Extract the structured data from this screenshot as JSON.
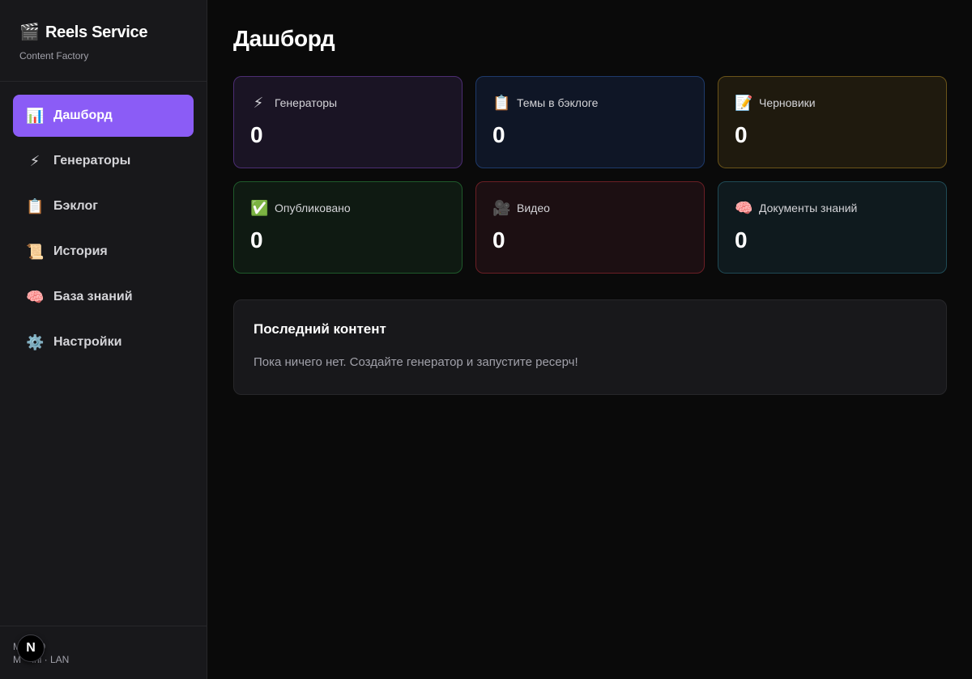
{
  "brand": {
    "icon": "🎬",
    "title": "Reels Service",
    "subtitle": "Content Factory"
  },
  "nav": [
    {
      "icon": "📊",
      "label": "Дашборд",
      "active": true
    },
    {
      "icon": "⚡",
      "label": "Генераторы"
    },
    {
      "icon": "📋",
      "label": "Бэклог"
    },
    {
      "icon": "📜",
      "label": "История"
    },
    {
      "icon": "🧠",
      "label": "База знаний"
    },
    {
      "icon": "⚙️",
      "label": "Настройки"
    }
  ],
  "footer": {
    "line1": "M      .0",
    "line2": "M    ini · LAN",
    "badge": "N"
  },
  "page": {
    "title": "Дашборд"
  },
  "stats": [
    {
      "icon": "⚡",
      "label": "Генераторы",
      "value": "0",
      "bg": "#1a1424",
      "border": "#4c2d73"
    },
    {
      "icon": "📋",
      "label": "Темы в бэклоге",
      "value": "0",
      "bg": "#0f1626",
      "border": "#1e3a6b"
    },
    {
      "icon": "📝",
      "label": "Черновики",
      "value": "0",
      "bg": "#1f1a0e",
      "border": "#6b5419"
    },
    {
      "icon": "✅",
      "label": "Опубликовано",
      "value": "0",
      "bg": "#0f1a12",
      "border": "#1f5a2b"
    },
    {
      "icon": "🎥",
      "label": "Видео",
      "value": "0",
      "bg": "#1c0f12",
      "border": "#6b1f25"
    },
    {
      "icon": "🧠",
      "label": "Документы знаний",
      "value": "0",
      "bg": "#0f1a1e",
      "border": "#1f4a55"
    }
  ],
  "recent": {
    "title": "Последний контент",
    "text": "Пока ничего нет. Создайте генератор и запустите ресерч!"
  }
}
